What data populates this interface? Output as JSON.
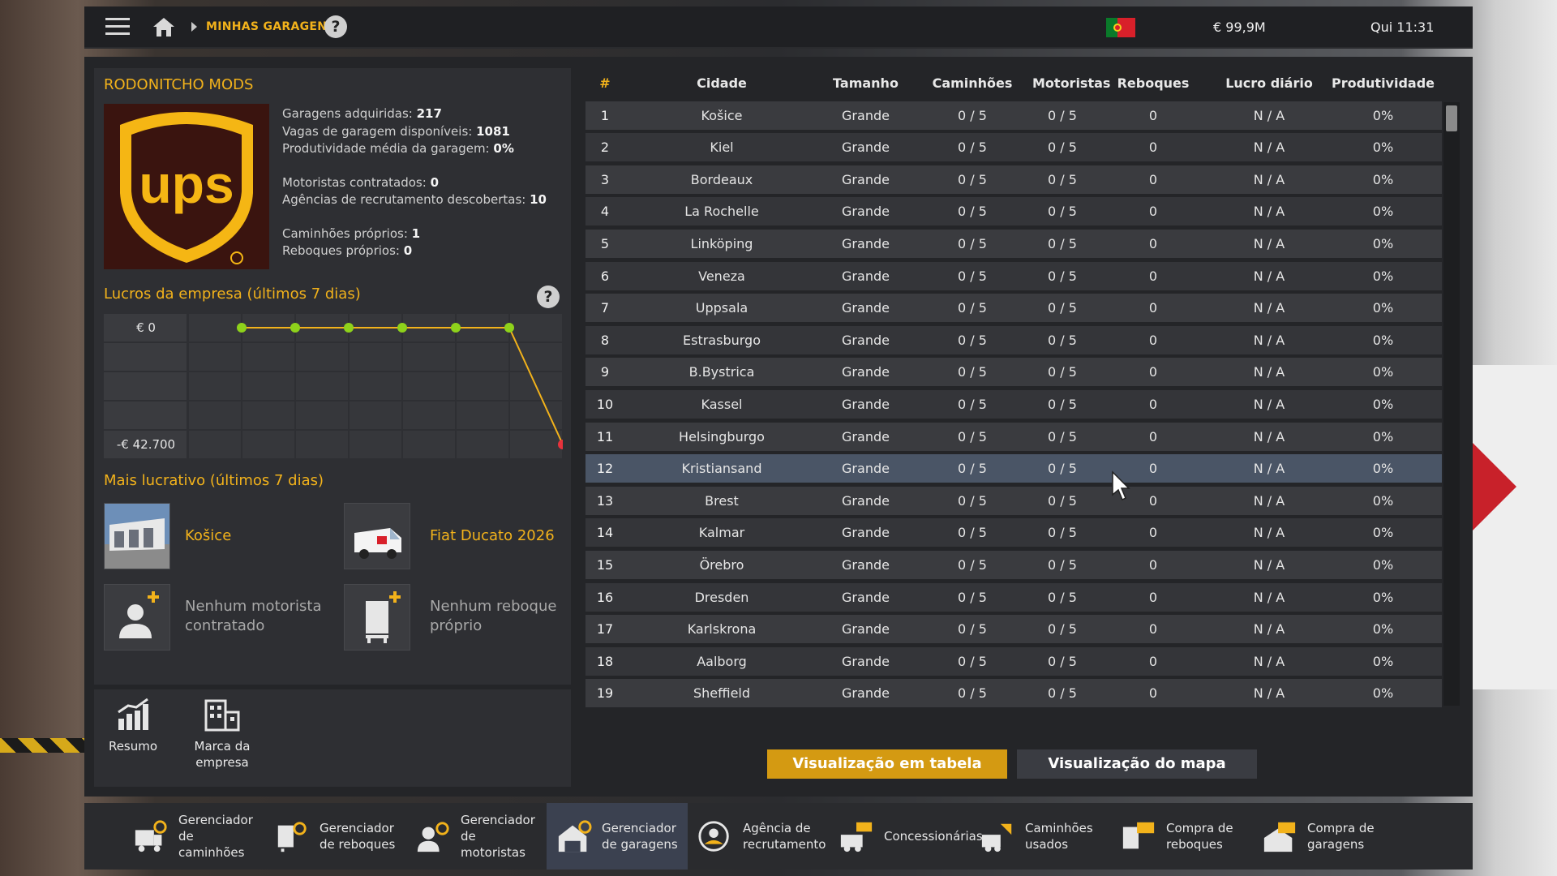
{
  "topbar": {
    "breadcrumb": "MINHAS GARAGENS",
    "help": "?",
    "money": "€ 99,9M",
    "clock": "Qui 11:31",
    "flag_icon": "portugal-flag-icon"
  },
  "company": {
    "name": "RODONITCHO MODS",
    "logo_icon": "ups-logo",
    "stats": [
      {
        "label": "Garagens adquiridas:",
        "value": "217"
      },
      {
        "label": "Vagas de garagem disponíveis:",
        "value": "1081"
      },
      {
        "label": "Produtividade média da garagem:",
        "value": "0%"
      },
      {
        "label": "Motoristas contratados:",
        "value": "0"
      },
      {
        "label": "Agências de recrutamento descobertas:",
        "value": "10"
      },
      {
        "label": "Caminhões próprios:",
        "value": "1"
      },
      {
        "label": "Reboques próprios:",
        "value": "0"
      }
    ]
  },
  "profit": {
    "title": "Lucros da empresa (últimos 7 dias)",
    "help": "?"
  },
  "chart_data": {
    "type": "line",
    "title": "Lucros da empresa (últimos 7 dias)",
    "x": [
      1,
      2,
      3,
      4,
      5,
      6,
      7
    ],
    "values": [
      0,
      0,
      0,
      0,
      0,
      0,
      -42700
    ],
    "ylim": [
      -42700,
      0
    ],
    "ytick_labels": [
      "€ 0",
      "-€ 42.700"
    ],
    "grid": true,
    "colors": {
      "line": "#f2b21b",
      "point": "#8ed21b",
      "last_point": "#e8323c"
    }
  },
  "best": {
    "title": "Mais lucrativo (últimos 7 dias)",
    "garage": "Košice",
    "truck": "Fiat Ducato 2026",
    "driver": "Nenhum motorista contratado",
    "trailer": "Nenhum reboque próprio"
  },
  "leftnav": {
    "summary": "Resumo",
    "brand": "Marca da empresa"
  },
  "table": {
    "headers": [
      "#",
      "Cidade",
      "Tamanho",
      "Caminhões",
      "Motoristas",
      "Reboques",
      "Lucro diário",
      "Produtividade"
    ],
    "selected_row": 12,
    "rows": [
      [
        "1",
        "Košice",
        "Grande",
        "0 / 5",
        "0 / 5",
        "0",
        "N / A",
        "0%"
      ],
      [
        "2",
        "Kiel",
        "Grande",
        "0 / 5",
        "0 / 5",
        "0",
        "N / A",
        "0%"
      ],
      [
        "3",
        "Bordeaux",
        "Grande",
        "0 / 5",
        "0 / 5",
        "0",
        "N / A",
        "0%"
      ],
      [
        "4",
        "La Rochelle",
        "Grande",
        "0 / 5",
        "0 / 5",
        "0",
        "N / A",
        "0%"
      ],
      [
        "5",
        "Linköping",
        "Grande",
        "0 / 5",
        "0 / 5",
        "0",
        "N / A",
        "0%"
      ],
      [
        "6",
        "Veneza",
        "Grande",
        "0 / 5",
        "0 / 5",
        "0",
        "N / A",
        "0%"
      ],
      [
        "7",
        "Uppsala",
        "Grande",
        "0 / 5",
        "0 / 5",
        "0",
        "N / A",
        "0%"
      ],
      [
        "8",
        "Estrasburgo",
        "Grande",
        "0 / 5",
        "0 / 5",
        "0",
        "N / A",
        "0%"
      ],
      [
        "9",
        "B.Bystrica",
        "Grande",
        "0 / 5",
        "0 / 5",
        "0",
        "N / A",
        "0%"
      ],
      [
        "10",
        "Kassel",
        "Grande",
        "0 / 5",
        "0 / 5",
        "0",
        "N / A",
        "0%"
      ],
      [
        "11",
        "Helsingburgo",
        "Grande",
        "0 / 5",
        "0 / 5",
        "0",
        "N / A",
        "0%"
      ],
      [
        "12",
        "Kristiansand",
        "Grande",
        "0 / 5",
        "0 / 5",
        "0",
        "N / A",
        "0%"
      ],
      [
        "13",
        "Brest",
        "Grande",
        "0 / 5",
        "0 / 5",
        "0",
        "N / A",
        "0%"
      ],
      [
        "14",
        "Kalmar",
        "Grande",
        "0 / 5",
        "0 / 5",
        "0",
        "N / A",
        "0%"
      ],
      [
        "15",
        "Örebro",
        "Grande",
        "0 / 5",
        "0 / 5",
        "0",
        "N / A",
        "0%"
      ],
      [
        "16",
        "Dresden",
        "Grande",
        "0 / 5",
        "0 / 5",
        "0",
        "N / A",
        "0%"
      ],
      [
        "17",
        "Karlskrona",
        "Grande",
        "0 / 5",
        "0 / 5",
        "0",
        "N / A",
        "0%"
      ],
      [
        "18",
        "Aalborg",
        "Grande",
        "0 / 5",
        "0 / 5",
        "0",
        "N / A",
        "0%"
      ],
      [
        "19",
        "Sheffield",
        "Grande",
        "0 / 5",
        "0 / 5",
        "0",
        "N / A",
        "0%"
      ]
    ]
  },
  "view": {
    "table_label": "Visualização em tabela",
    "map_label": "Visualização do mapa"
  },
  "bottombar": [
    {
      "label": "Gerenciador de caminhões",
      "icon": "truck-manager-icon",
      "active": false
    },
    {
      "label": "Gerenciador de reboques",
      "icon": "trailer-manager-icon",
      "active": false
    },
    {
      "label": "Gerenciador de motoristas",
      "icon": "driver-manager-icon",
      "active": false
    },
    {
      "label": "Gerenciador de garagens",
      "icon": "garage-manager-icon",
      "active": true
    },
    {
      "label": "Agência de recrutamento",
      "icon": "recruitment-agency-icon",
      "active": false
    },
    {
      "label": "Concessionárias",
      "icon": "dealership-icon",
      "active": false
    },
    {
      "label": "Caminhões usados",
      "icon": "used-trucks-icon",
      "active": false
    },
    {
      "label": "Compra de reboques",
      "icon": "buy-trailers-icon",
      "active": false
    },
    {
      "label": "Compra de garagens",
      "icon": "buy-garages-icon",
      "active": false
    }
  ],
  "colors": {
    "accent": "#f2b21b",
    "button_active": "#d49a12",
    "row_selected": "#4a5566"
  }
}
